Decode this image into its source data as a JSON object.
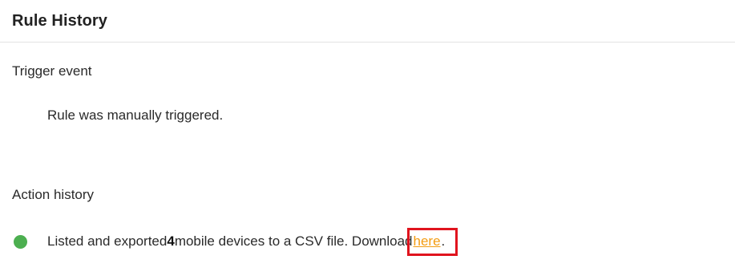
{
  "header": {
    "title": "Rule History"
  },
  "trigger": {
    "section_title": "Trigger event",
    "text": "Rule was manually triggered."
  },
  "action_history": {
    "section_title": "Action history",
    "status_color": "#4caf50",
    "entry": {
      "text_before": "Listed and exported ",
      "count": "4",
      "text_middle": " mobile devices to a CSV file. Download ",
      "link_label": "here",
      "text_after": "."
    }
  },
  "highlight_color": "#e0141e",
  "link_color": "#f39c12"
}
